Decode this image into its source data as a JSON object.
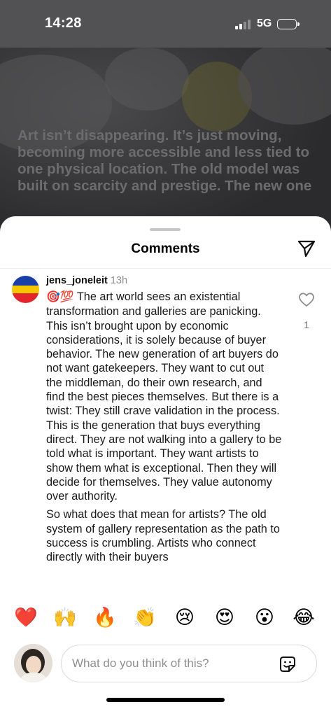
{
  "status_bar": {
    "time": "14:28",
    "network": "5G"
  },
  "background_post": {
    "overlay_text": "Art isn’t disappearing. It’s just moving, becoming more accessible and less tied to one physical location. The old model was built on scarcity and prestige. The new one"
  },
  "sheet": {
    "title": "Comments",
    "share_icon": "paper-plane-icon"
  },
  "comment": {
    "username": "jens_joneleit",
    "time_ago": "13h",
    "leading_emojis": "🎯💯",
    "paragraph_1": "The art world sees an existential transformation and galleries are panicking. This isn’t brought upon by economic considerations, it is solely because of buyer behavior. The new generation of art buyers do not want gatekeepers. They want to cut out the middleman, do their own research, and find the best pieces themselves. But there is a twist: They still crave validation in the process. This is the generation that buys everything direct. They are not walking into a gallery to be told what is important. They want artists to show them what is exceptional. Then they will decide for themselves. They value autonomy over authority.",
    "paragraph_2": "So what does that mean for artists? The old system of gallery representation as the path to success is crumbling. Artists who connect directly with their buyers",
    "like_count": "1",
    "like_icon": "heart-outline-icon",
    "avatar_colors": [
      "#1a3fa6",
      "#f6c700",
      "#e3262b"
    ]
  },
  "reactions": [
    "❤️",
    "🙌",
    "🔥",
    "👏",
    "😢",
    "😍",
    "😮",
    "😂"
  ],
  "composer": {
    "placeholder": "What do you think of this?",
    "sticker_icon": "sticker-icon"
  }
}
